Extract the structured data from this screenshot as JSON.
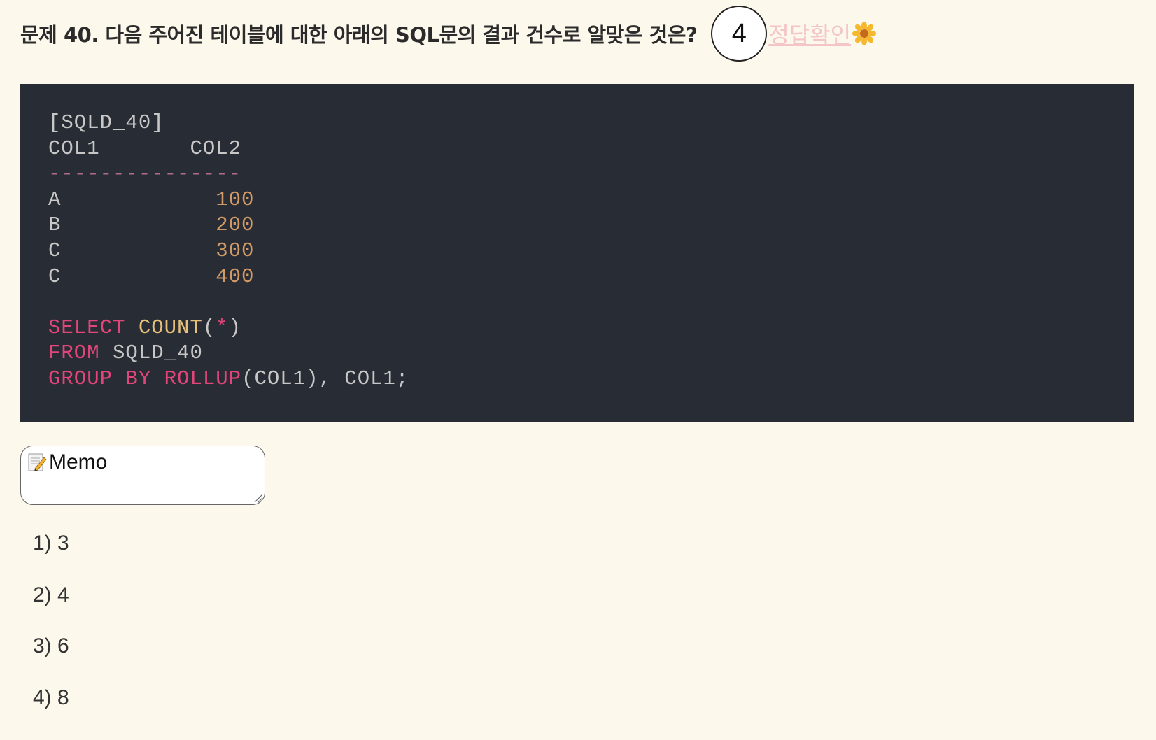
{
  "question": {
    "title": "문제 40. 다음 주어진 테이블에 대한 아래의 SQL문의 결과 건수로 알맞은 것은?",
    "answer": "4",
    "check_label": "정답확인",
    "flower_icon": "sunflower-icon"
  },
  "code": {
    "table_name": "[SQLD_40]",
    "header_col1": "COL1",
    "header_col2": "COL2",
    "separator": "---------------",
    "rows": [
      {
        "col1": "A",
        "col2": "100"
      },
      {
        "col1": "B",
        "col2": "200"
      },
      {
        "col1": "C",
        "col2": "300"
      },
      {
        "col1": "C",
        "col2": "400"
      }
    ],
    "sql": {
      "select_kw": "SELECT",
      "count_fn": "COUNT",
      "open_paren": "(",
      "star": "*",
      "close_paren": ")",
      "from_kw": "FROM",
      "table": "SQLD_40",
      "group_kw": "GROUP",
      "by_kw": "BY",
      "rollup_kw": "ROLLUP",
      "rollup_args": "(COL1), COL1;"
    }
  },
  "memo": {
    "label": "Memo",
    "icon": "memo-icon"
  },
  "options": [
    "1) 3",
    "2) 4",
    "3) 6",
    "4) 8"
  ],
  "colors": {
    "background": "#fdf8ec",
    "code_bg": "#282c34",
    "keyword": "#e2457a",
    "function": "#e6c07b",
    "number": "#d19a66",
    "link": "#f4c4c8"
  }
}
